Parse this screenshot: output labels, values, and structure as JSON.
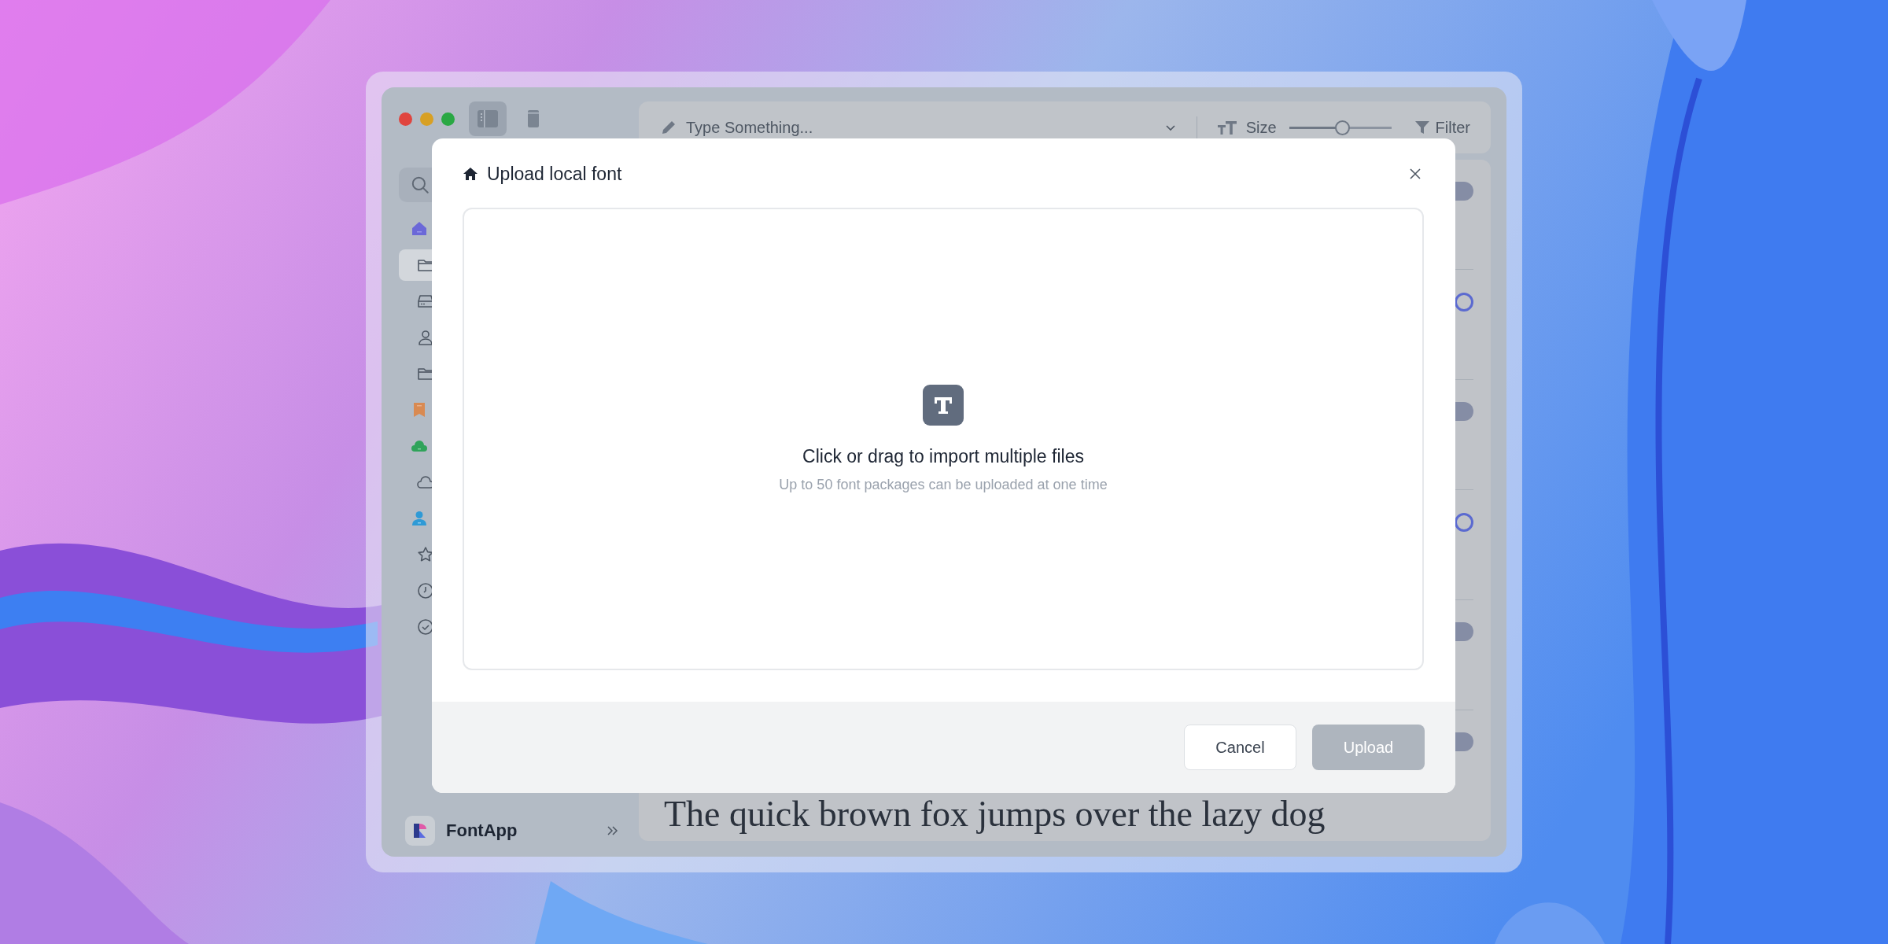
{
  "window": {
    "view_buttons": [
      {
        "selected": true
      },
      {
        "selected": false
      }
    ]
  },
  "sidebar": {
    "items": [
      {
        "kind": "section",
        "selected": false
      },
      {
        "kind": "item",
        "selected": true
      },
      {
        "kind": "item",
        "selected": false
      },
      {
        "kind": "item",
        "selected": false
      },
      {
        "kind": "item",
        "selected": false
      },
      {
        "kind": "section",
        "selected": false
      },
      {
        "kind": "section",
        "selected": false
      },
      {
        "kind": "item",
        "selected": false
      },
      {
        "kind": "section",
        "selected": false
      },
      {
        "kind": "item",
        "selected": false
      },
      {
        "kind": "item",
        "selected": false
      },
      {
        "kind": "item",
        "selected": false
      }
    ],
    "app_name": "FontApp"
  },
  "toolbar": {
    "input": {
      "placeholder": "Type Something..."
    },
    "size_label": "Size",
    "size_slider": {
      "level": 0.52
    },
    "filter_label": "Filter"
  },
  "font_list": {
    "rows": [
      {
        "on": false
      },
      {
        "on": true
      },
      {
        "on": false
      },
      {
        "on": true
      },
      {
        "on": false
      },
      {
        "on": false
      }
    ],
    "preview_text": "The quick brown fox jumps over the lazy dog"
  },
  "dialog": {
    "title": "Upload local font",
    "dropzone": {
      "text": "Click or drag to import multiple files",
      "hint": "Up to 50 font packages can be uploaded at one time"
    },
    "buttons": [
      {
        "label": "Cancel",
        "kind": "secondary",
        "disabled": false
      },
      {
        "label": "Upload",
        "kind": "primary",
        "disabled": true
      }
    ]
  }
}
